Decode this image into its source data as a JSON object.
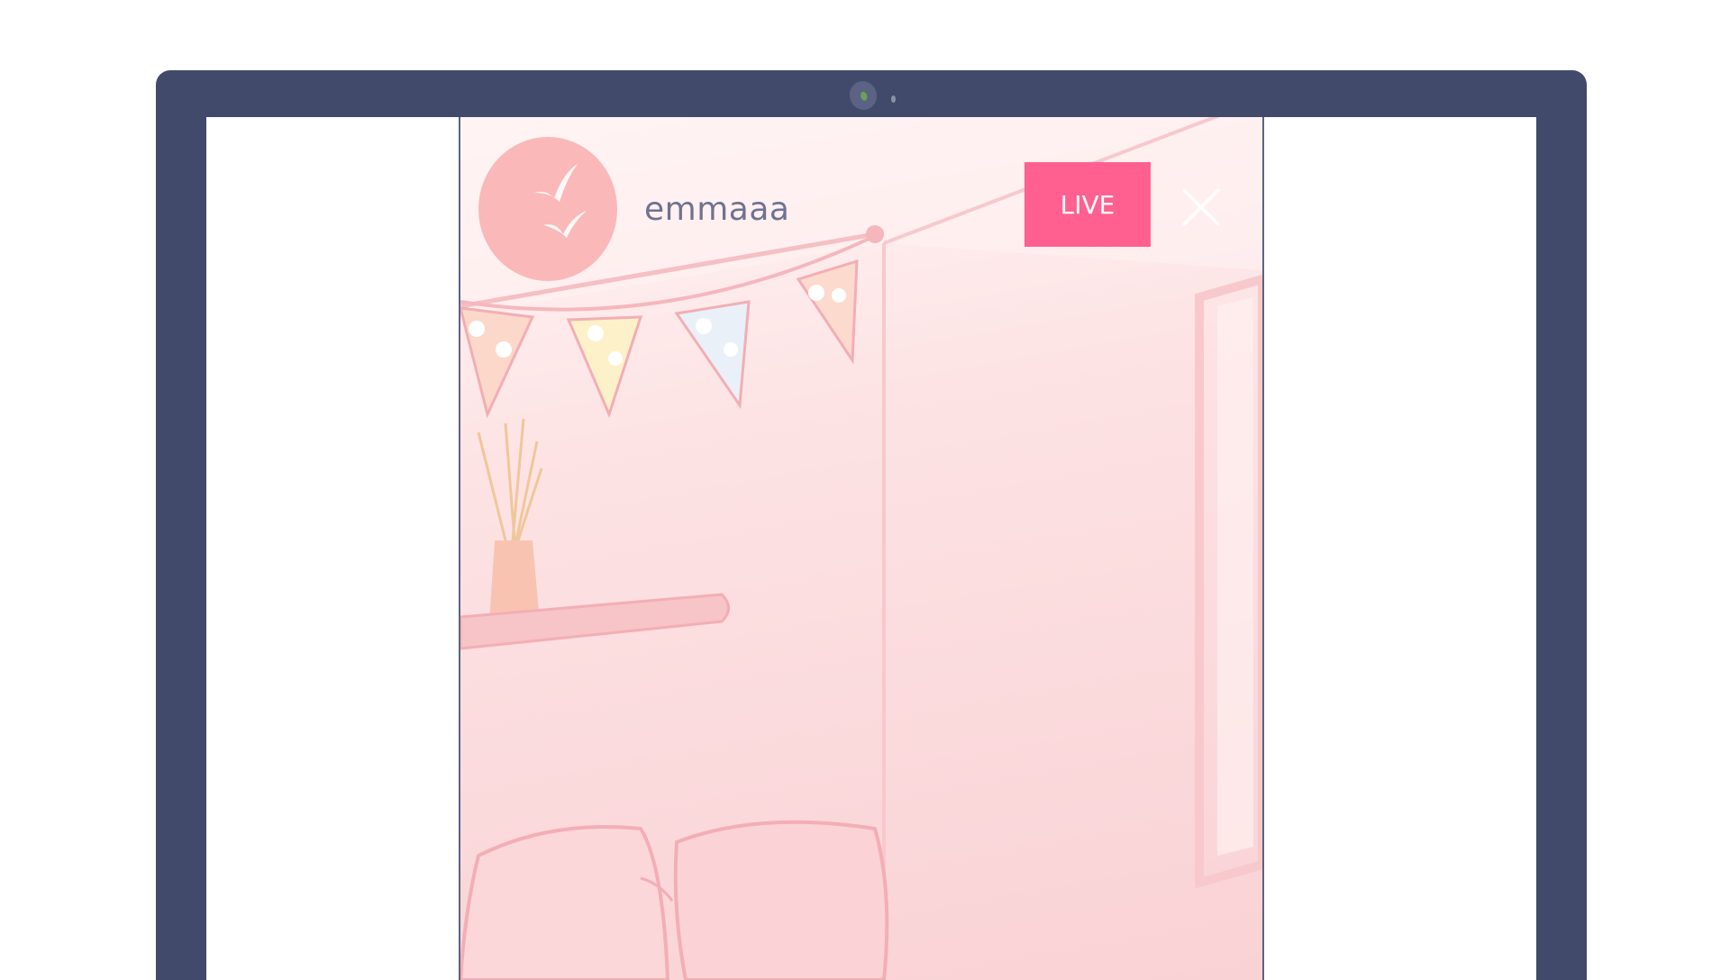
{
  "stream": {
    "username": "emmaaa",
    "live_label": "LIVE"
  },
  "icons": {
    "avatar": "birds-icon",
    "close": "close-icon",
    "webcam": "webcam-icon"
  },
  "colors": {
    "frame": "#414a6a",
    "live_button": "#ff6090",
    "avatar_bg": "#fbb8b8",
    "username_text": "#6f7290"
  }
}
